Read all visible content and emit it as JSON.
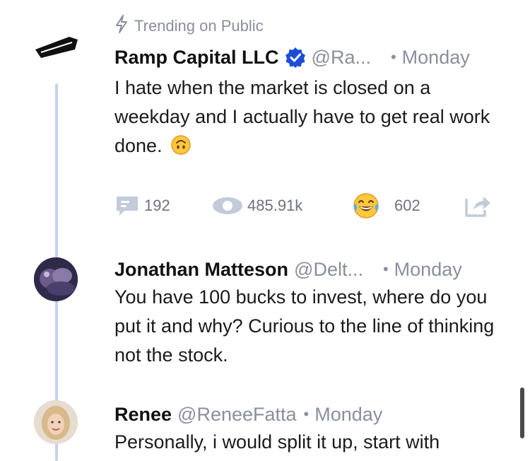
{
  "trending": {
    "label": "Trending on Public"
  },
  "main_post": {
    "author": "Ramp Capital LLC",
    "handle": "@Ra...",
    "time": "Monday",
    "text": "I hate when the market is closed on a weekday and I actually have to get real work done.",
    "emoji_icon": "upside-down-face-icon",
    "actions": {
      "comments": "192",
      "views": "485.91k",
      "reactions": "602",
      "reaction_icon": "laughing-tears-emoji-icon",
      "share_icon": "share-icon"
    }
  },
  "replies": [
    {
      "author": "Jonathan Matteson",
      "handle": "@Delt...",
      "time": "Monday",
      "text": "You have 100 bucks to invest, where do you put it and why? Curious to the line of thinking not the stock."
    },
    {
      "author": "Renee",
      "handle": "@ReneeFatta",
      "time": "Monday",
      "text": "Personally, i would split it up, start with"
    }
  ],
  "colors": {
    "verified": "#1d4ed8",
    "thread_line": "#c9d0e8",
    "muted": "#8a8f9c"
  }
}
